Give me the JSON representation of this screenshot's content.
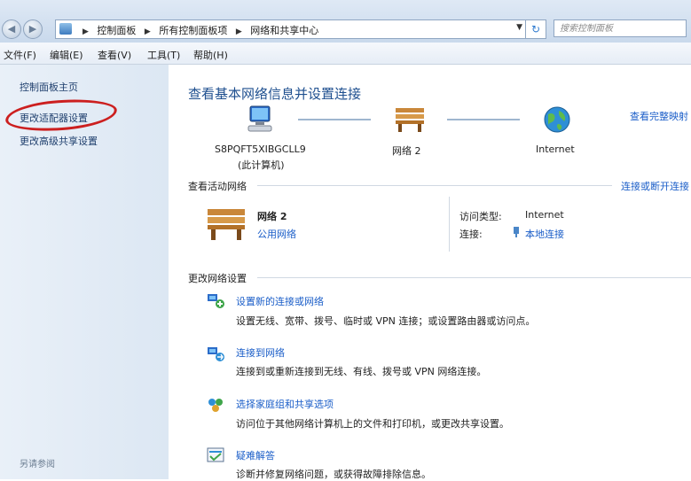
{
  "breadcrumbs": [
    "控制面板",
    "所有控制面板项",
    "网络和共享中心"
  ],
  "search": {
    "placeholder": "搜索控制面板"
  },
  "menu": [
    "文件(F)",
    "编辑(E)",
    "查看(V)",
    "工具(T)",
    "帮助(H)"
  ],
  "sidebar": {
    "links": [
      "控制面板主页",
      "更改适配器设置",
      "更改高级共享设置"
    ],
    "see_also": "另请参阅"
  },
  "main": {
    "title": "查看基本网络信息并设置连接",
    "view_full_map": "查看完整映射",
    "network_map": {
      "computer_name": "S8PQFT5XIBGCLL9",
      "computer_sub": "(此计算机)",
      "network": "网络  2",
      "internet": "Internet"
    },
    "active": {
      "heading": "查看活动网络",
      "connect_link": "连接或断开连接",
      "network_name": "网络  2",
      "network_type": "公用网络",
      "access_type_label": "访问类型:",
      "access_type_value": "Internet",
      "connections_label": "连接:",
      "connections_value": "本地连接"
    },
    "change": {
      "heading": "更改网络设置",
      "tasks": [
        {
          "title": "设置新的连接或网络",
          "desc": "设置无线、宽带、拨号、临时或 VPN 连接；或设置路由器或访问点。",
          "icon": "new-connection-icon"
        },
        {
          "title": "连接到网络",
          "desc": "连接到或重新连接到无线、有线、拨号或 VPN 网络连接。",
          "icon": "connect-network-icon"
        },
        {
          "title": "选择家庭组和共享选项",
          "desc": "访问位于其他网络计算机上的文件和打印机，或更改共享设置。",
          "icon": "homegroup-icon"
        },
        {
          "title": "疑难解答",
          "desc": "诊断并修复网络问题，或获得故障排除信息。",
          "icon": "troubleshoot-icon"
        }
      ]
    }
  }
}
